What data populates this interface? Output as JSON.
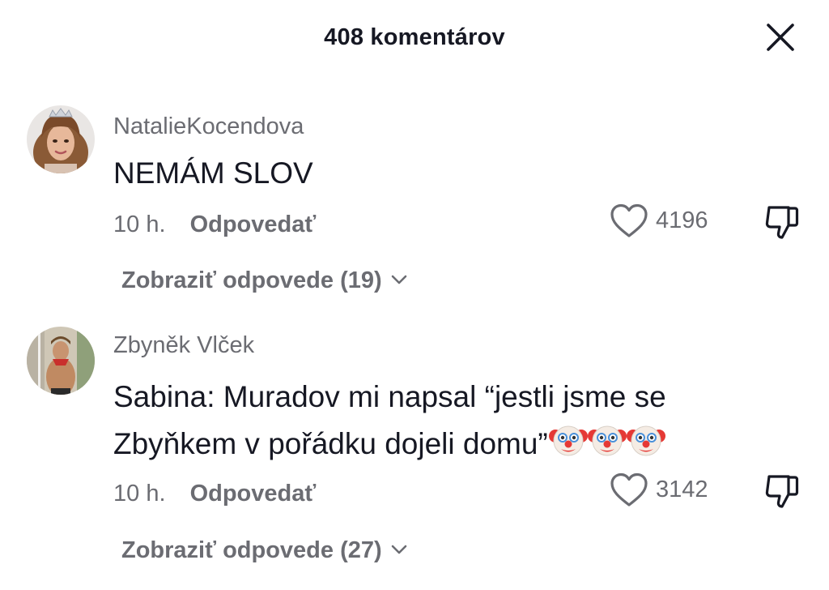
{
  "header": {
    "title": "408 komentárov",
    "close_icon": "close-icon"
  },
  "colors": {
    "text_primary": "#161823",
    "text_secondary": "#6b6c72",
    "background": "#ffffff"
  },
  "comments": [
    {
      "username": "NatalieKocendova",
      "text": "NEMÁM SLOV",
      "time": "10 h.",
      "reply_label": "Odpovedať",
      "like_count": "4196",
      "view_replies_label": "Zobraziť odpovede (19)"
    },
    {
      "username": "Zbyněk Vlček",
      "text": "Sabina: Muradov mi napsal “jestli jsme se Zbyňkem v pořádku dojeli domu”",
      "emoji": "clown-face",
      "emoji_count": 3,
      "time": "10 h.",
      "reply_label": "Odpovedať",
      "like_count": "3142",
      "view_replies_label": "Zobraziť odpovede (27)"
    }
  ]
}
